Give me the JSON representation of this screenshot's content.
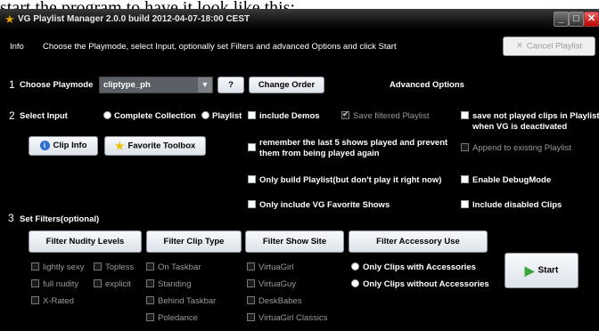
{
  "caption": "start the program to have it look like this:",
  "window": {
    "title": "VG Playlist Manager 2.0.0 build 2012-04-07-18:00 CEST",
    "controls": {
      "minimize": "_",
      "maximize": "□",
      "close": "✕"
    }
  },
  "info": {
    "label": "Info",
    "message": "Choose the Playmode, select Input, optionally set Filters and advanced Options and click Start",
    "cancel_button": "Cancel Playlist"
  },
  "section1": {
    "number": "1",
    "label": "Choose Playmode",
    "playmode_value": "cliptype_ph",
    "help_button": "?",
    "change_order_button": "Change Order"
  },
  "advanced_options_label": "Advanced Options",
  "section2": {
    "number": "2",
    "label": "Select Input",
    "radio_complete": "Complete Collection",
    "radio_playlist": "Playlist",
    "clip_info_button": "Clip Info",
    "favorite_toolbox_button": "Favorite Toolbox"
  },
  "options": {
    "include_demos": "include Demos",
    "save_filtered_playlist": "Save filtered Playlist",
    "save_not_played_1": "save not played clips in Playlist",
    "save_not_played_2": "when VG is deactivated",
    "remember_last_1": "remember the last 5 shows played and prevent",
    "remember_last_2": "them from being played again",
    "append_playlist": "Append to existing Playlist",
    "only_build_playlist": "Only build Playlist(but don't play it right now)",
    "enable_debug": "Enable DebugMode",
    "only_favorites": "Only include VG Favorite Shows",
    "include_disabled": "Include disabled Clips"
  },
  "section3": {
    "number": "3",
    "label": "Set Filters(optional)",
    "buttons": {
      "nudity": "Filter Nudity Levels",
      "clip_type": "Filter Clip Type",
      "show_site": "Filter Show Site",
      "accessory": "Filter Accessory Use"
    },
    "nudity": {
      "lightly_sexy": "lightly sexy",
      "topless": "Topless",
      "full_nudity": "full nudity",
      "explicit": "explicit",
      "x_rated": "X-Rated"
    },
    "clip_type": {
      "on_taskbar": "On Taskbar",
      "standing": "Standing",
      "behind_taskbar": "Behind Taskbar",
      "poledance": "Poledance"
    },
    "show_site": {
      "virtuagirl": "VirtuaGirl",
      "virtuaguy": "VirtuaGuy",
      "deskbabes": "DeskBabes",
      "virtuagirl_classics": "VirtuaGirl Classics"
    },
    "accessory": {
      "with": "Only Clips with Accessories",
      "without": "Only Clips without Accessories"
    }
  },
  "start_button": "Start",
  "colors": {
    "background": "#000000",
    "button": "#eef1f5",
    "start_arrow": "#3aa33a"
  }
}
